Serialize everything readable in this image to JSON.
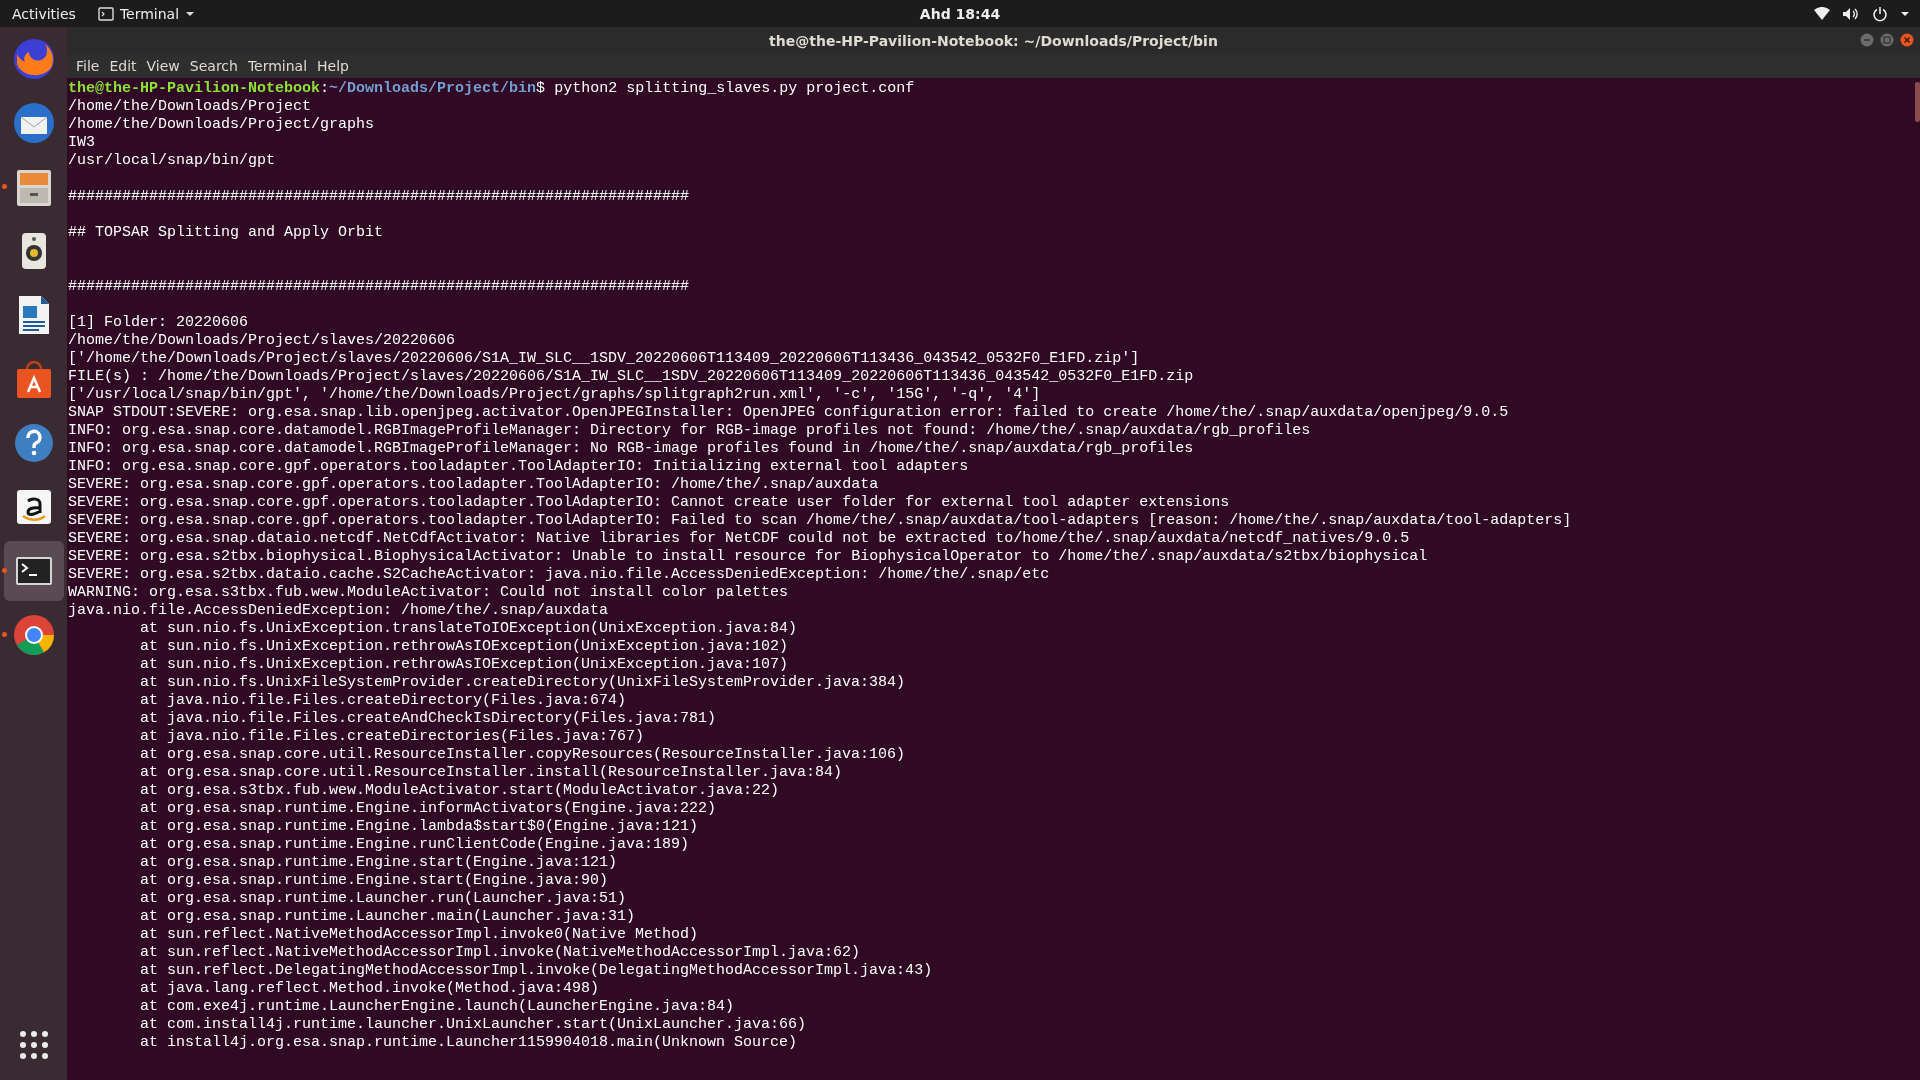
{
  "top_bar": {
    "activities": "Activities",
    "app_menu": "Terminal",
    "clock": "Ahd 18:44"
  },
  "dock": {
    "items": [
      {
        "kind": "browser",
        "running": false,
        "selected": false
      },
      {
        "kind": "mail",
        "running": false,
        "selected": false
      },
      {
        "kind": "files",
        "running": true,
        "selected": false
      },
      {
        "kind": "audio",
        "running": false,
        "selected": false
      },
      {
        "kind": "writer",
        "running": false,
        "selected": false
      },
      {
        "kind": "store",
        "running": false,
        "selected": false
      },
      {
        "kind": "help",
        "running": false,
        "selected": false
      },
      {
        "kind": "shop",
        "running": false,
        "selected": false
      },
      {
        "kind": "terminal",
        "running": true,
        "selected": true
      },
      {
        "kind": "chrome",
        "running": true,
        "selected": false
      }
    ]
  },
  "window": {
    "title": "the@the-HP-Pavilion-Notebook: ~/Downloads/Project/bin",
    "menu": [
      "File",
      "Edit",
      "View",
      "Search",
      "Terminal",
      "Help"
    ]
  },
  "terminal": {
    "lines": [
      {
        "kind": "prompt",
        "user": "the@the-HP-Pavilion-Notebook",
        "separator": ":",
        "path": "~/Downloads/Project/bin",
        "symbol": "$",
        "command": "python2 splitting_slaves.py project.conf"
      },
      {
        "kind": "output",
        "text": "/home/the/Downloads/Project"
      },
      {
        "kind": "output",
        "text": "/home/the/Downloads/Project/graphs"
      },
      {
        "kind": "output",
        "text": "IW3"
      },
      {
        "kind": "output",
        "text": "/usr/local/snap/bin/gpt"
      },
      {
        "kind": "blank"
      },
      {
        "kind": "output",
        "text": "#####################################################################"
      },
      {
        "kind": "blank"
      },
      {
        "kind": "output",
        "text": "## TOPSAR Splitting and Apply Orbit"
      },
      {
        "kind": "blank"
      },
      {
        "kind": "blank"
      },
      {
        "kind": "output",
        "text": "#####################################################################"
      },
      {
        "kind": "blank"
      },
      {
        "kind": "output",
        "text": "[1] Folder: 20220606"
      },
      {
        "kind": "output",
        "text": "/home/the/Downloads/Project/slaves/20220606"
      },
      {
        "kind": "output",
        "text": "['/home/the/Downloads/Project/slaves/20220606/S1A_IW_SLC__1SDV_20220606T113409_20220606T113436_043542_0532F0_E1FD.zip']"
      },
      {
        "kind": "output",
        "text": "FILE(s) : /home/the/Downloads/Project/slaves/20220606/S1A_IW_SLC__1SDV_20220606T113409_20220606T113436_043542_0532F0_E1FD.zip"
      },
      {
        "kind": "output",
        "text": "['/usr/local/snap/bin/gpt', '/home/the/Downloads/Project/graphs/splitgraph2run.xml', '-c', '15G', '-q', '4']"
      },
      {
        "kind": "output",
        "text": "SNAP STDOUT:SEVERE: org.esa.snap.lib.openjpeg.activator.OpenJPEGInstaller: OpenJPEG configuration error: failed to create /home/the/.snap/auxdata/openjpeg/9.0.5"
      },
      {
        "kind": "output",
        "text": "INFO: org.esa.snap.core.datamodel.RGBImageProfileManager: Directory for RGB-image profiles not found: /home/the/.snap/auxdata/rgb_profiles"
      },
      {
        "kind": "output",
        "text": "INFO: org.esa.snap.core.datamodel.RGBImageProfileManager: No RGB-image profiles found in /home/the/.snap/auxdata/rgb_profiles"
      },
      {
        "kind": "output",
        "text": "INFO: org.esa.snap.core.gpf.operators.tooladapter.ToolAdapterIO: Initializing external tool adapters"
      },
      {
        "kind": "output",
        "text": "SEVERE: org.esa.snap.core.gpf.operators.tooladapter.ToolAdapterIO: /home/the/.snap/auxdata"
      },
      {
        "kind": "output",
        "text": "SEVERE: org.esa.snap.core.gpf.operators.tooladapter.ToolAdapterIO: Cannot create user folder for external tool adapter extensions"
      },
      {
        "kind": "output",
        "text": "SEVERE: org.esa.snap.core.gpf.operators.tooladapter.ToolAdapterIO: Failed to scan /home/the/.snap/auxdata/tool-adapters [reason: /home/the/.snap/auxdata/tool-adapters]"
      },
      {
        "kind": "output",
        "text": "SEVERE: org.esa.snap.dataio.netcdf.NetCdfActivator: Native libraries for NetCDF could not be extracted to/home/the/.snap/auxdata/netcdf_natives/9.0.5"
      },
      {
        "kind": "output",
        "text": "SEVERE: org.esa.s2tbx.biophysical.BiophysicalActivator: Unable to install resource for BiophysicalOperator to /home/the/.snap/auxdata/s2tbx/biophysical"
      },
      {
        "kind": "output",
        "text": "SEVERE: org.esa.s2tbx.dataio.cache.S2CacheActivator: java.nio.file.AccessDeniedException: /home/the/.snap/etc"
      },
      {
        "kind": "output",
        "text": "WARNING: org.esa.s3tbx.fub.wew.ModuleActivator: Could not install color palettes"
      },
      {
        "kind": "output",
        "text": "java.nio.file.AccessDeniedException: /home/the/.snap/auxdata"
      },
      {
        "kind": "trace",
        "text": "at sun.nio.fs.UnixException.translateToIOException(UnixException.java:84)"
      },
      {
        "kind": "trace",
        "text": "at sun.nio.fs.UnixException.rethrowAsIOException(UnixException.java:102)"
      },
      {
        "kind": "trace",
        "text": "at sun.nio.fs.UnixException.rethrowAsIOException(UnixException.java:107)"
      },
      {
        "kind": "trace",
        "text": "at sun.nio.fs.UnixFileSystemProvider.createDirectory(UnixFileSystemProvider.java:384)"
      },
      {
        "kind": "trace",
        "text": "at java.nio.file.Files.createDirectory(Files.java:674)"
      },
      {
        "kind": "trace",
        "text": "at java.nio.file.Files.createAndCheckIsDirectory(Files.java:781)"
      },
      {
        "kind": "trace",
        "text": "at java.nio.file.Files.createDirectories(Files.java:767)"
      },
      {
        "kind": "trace",
        "text": "at org.esa.snap.core.util.ResourceInstaller.copyResources(ResourceInstaller.java:106)"
      },
      {
        "kind": "trace",
        "text": "at org.esa.snap.core.util.ResourceInstaller.install(ResourceInstaller.java:84)"
      },
      {
        "kind": "trace",
        "text": "at org.esa.s3tbx.fub.wew.ModuleActivator.start(ModuleActivator.java:22)"
      },
      {
        "kind": "trace",
        "text": "at org.esa.snap.runtime.Engine.informActivators(Engine.java:222)"
      },
      {
        "kind": "trace",
        "text": "at org.esa.snap.runtime.Engine.lambda$start$0(Engine.java:121)"
      },
      {
        "kind": "trace",
        "text": "at org.esa.snap.runtime.Engine.runClientCode(Engine.java:189)"
      },
      {
        "kind": "trace",
        "text": "at org.esa.snap.runtime.Engine.start(Engine.java:121)"
      },
      {
        "kind": "trace",
        "text": "at org.esa.snap.runtime.Engine.start(Engine.java:90)"
      },
      {
        "kind": "trace",
        "text": "at org.esa.snap.runtime.Launcher.run(Launcher.java:51)"
      },
      {
        "kind": "trace",
        "text": "at org.esa.snap.runtime.Launcher.main(Launcher.java:31)"
      },
      {
        "kind": "trace",
        "text": "at sun.reflect.NativeMethodAccessorImpl.invoke0(Native Method)"
      },
      {
        "kind": "trace",
        "text": "at sun.reflect.NativeMethodAccessorImpl.invoke(NativeMethodAccessorImpl.java:62)"
      },
      {
        "kind": "trace",
        "text": "at sun.reflect.DelegatingMethodAccessorImpl.invoke(DelegatingMethodAccessorImpl.java:43)"
      },
      {
        "kind": "trace",
        "text": "at java.lang.reflect.Method.invoke(Method.java:498)"
      },
      {
        "kind": "trace",
        "text": "at com.exe4j.runtime.LauncherEngine.launch(LauncherEngine.java:84)"
      },
      {
        "kind": "trace",
        "text": "at com.install4j.runtime.launcher.UnixLauncher.start(UnixLauncher.java:66)"
      },
      {
        "kind": "trace",
        "text": "at install4j.org.esa.snap.runtime.Launcher1159904018.main(Unknown Source)"
      }
    ]
  }
}
